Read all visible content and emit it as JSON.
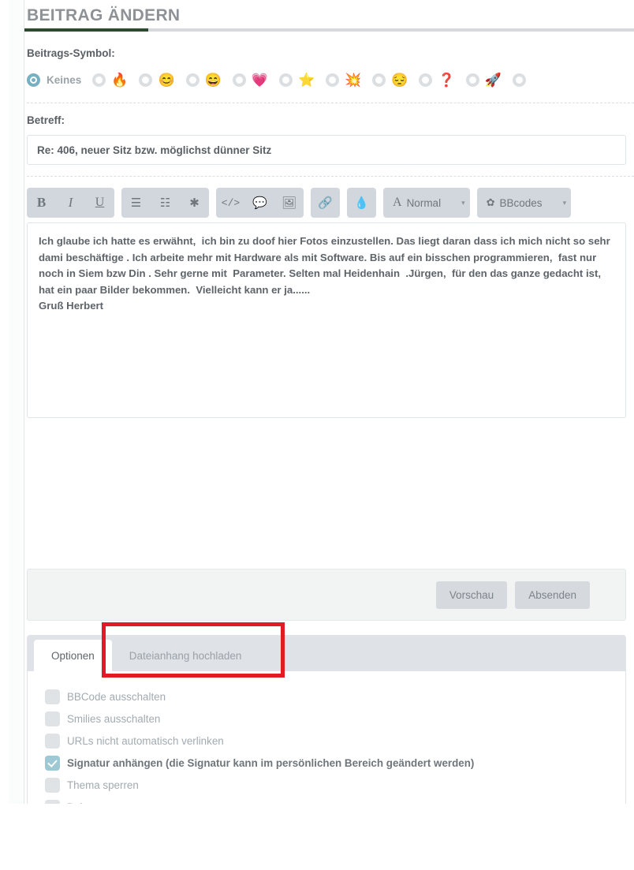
{
  "page": {
    "title": "BEITRAG ÄNDERN"
  },
  "icon_field": {
    "label": "Beitrags-Symbol:",
    "options": [
      {
        "name": "none",
        "label": "Keines",
        "emoji": "",
        "checked": true
      },
      {
        "name": "fire",
        "label": "",
        "emoji": "🔥",
        "checked": false
      },
      {
        "name": "smiling-face",
        "label": "",
        "emoji": "😊",
        "checked": false
      },
      {
        "name": "grinning-face",
        "label": "",
        "emoji": "😄",
        "checked": false
      },
      {
        "name": "heart",
        "label": "",
        "emoji": "💗",
        "checked": false
      },
      {
        "name": "star",
        "label": "",
        "emoji": "⭐",
        "checked": false
      },
      {
        "name": "collision",
        "label": "",
        "emoji": "💥",
        "checked": false
      },
      {
        "name": "relieved-face",
        "label": "",
        "emoji": "😔",
        "checked": false
      },
      {
        "name": "question-mark",
        "label": "",
        "emoji": "❓",
        "checked": false
      },
      {
        "name": "rocket",
        "label": "",
        "emoji": "🚀",
        "checked": false
      },
      {
        "name": "cut-off",
        "label": "",
        "emoji": "",
        "checked": false
      }
    ]
  },
  "subject_field": {
    "label": "Betreff:",
    "value": "Re: 406, neuer Sitz bzw. möglichst dünner Sitz",
    "placeholder": "Betreff"
  },
  "toolbar": {
    "groups": [
      {
        "name": "text-style",
        "buttons": [
          {
            "name": "bold-button",
            "glyph": "B",
            "style": "b"
          },
          {
            "name": "italic-button",
            "glyph": "I",
            "style": "i"
          },
          {
            "name": "underline-button",
            "glyph": "U",
            "style": "u"
          }
        ]
      },
      {
        "name": "list-style",
        "buttons": [
          {
            "name": "unordered-list-button",
            "glyph": "☰",
            "style": "plain"
          },
          {
            "name": "ordered-list-button",
            "glyph": "☷",
            "style": "plain"
          },
          {
            "name": "asterisk-button",
            "glyph": "✱",
            "style": "plain"
          }
        ]
      },
      {
        "name": "insert",
        "buttons": [
          {
            "name": "code-button",
            "glyph": "</>",
            "style": "code"
          },
          {
            "name": "quote-button",
            "glyph": "💬",
            "style": "plain"
          },
          {
            "name": "image-button",
            "glyph": "🖼",
            "style": "plain"
          }
        ]
      },
      {
        "name": "link",
        "buttons": [
          {
            "name": "link-button",
            "glyph": "🔗",
            "style": "plain"
          }
        ]
      },
      {
        "name": "color",
        "buttons": [
          {
            "name": "color-drop-button",
            "glyph": "💧",
            "style": "plain"
          }
        ]
      }
    ],
    "font_size_select": {
      "lead_glyph": "A",
      "label": "Normal",
      "caret": "▾"
    },
    "bbcodes_select": {
      "gear_glyph": "✿",
      "label": "BBcodes",
      "caret": "▾"
    }
  },
  "editor": {
    "value": "Ich glaube ich hatte es erwähnt,  ich bin zu doof hier Fotos einzustellen. Das liegt daran dass ich mich nicht so sehr dami beschäftige . Ich arbeite mehr mit Hardware als mit Software. Bis auf ein bisschen programmieren,  fast nur noch in Siem bzw Din . Sehr gerne mit  Parameter. Selten mal Heidenhain  .Jürgen,  für den das ganze gedacht ist,  hat ein paar Bilder bekommen.  Vielleicht kann er ja......\nGruß Herbert"
  },
  "submit_panel": {
    "preview_label": "Vorschau",
    "submit_label": "Absenden"
  },
  "tabs": [
    {
      "name": "tab-optionen",
      "label": "Optionen",
      "active": true
    },
    {
      "name": "tab-dateianhang",
      "label": "Dateianhang hochladen",
      "active": false
    }
  ],
  "options_panel": {
    "items": [
      {
        "name": "disable-bbcode",
        "label": "BBCode ausschalten",
        "checked": false
      },
      {
        "name": "disable-smilies",
        "label": "Smilies ausschalten",
        "checked": false
      },
      {
        "name": "disable-magic-urls",
        "label": "URLs nicht automatisch verlinken",
        "checked": false
      },
      {
        "name": "attach-signature",
        "label": "Signatur anhängen (die Signatur kann im persönlichen Bereich geändert werden)",
        "checked": true
      },
      {
        "name": "lock-topic",
        "label": "Thema sperren",
        "checked": false
      },
      {
        "name": "lock-post",
        "label": "Beitrag sperren",
        "checked": false
      }
    ]
  },
  "annotation": {
    "name": "red-highlight-box",
    "color": "#e01b24",
    "targets": "tab-dateianhang"
  }
}
